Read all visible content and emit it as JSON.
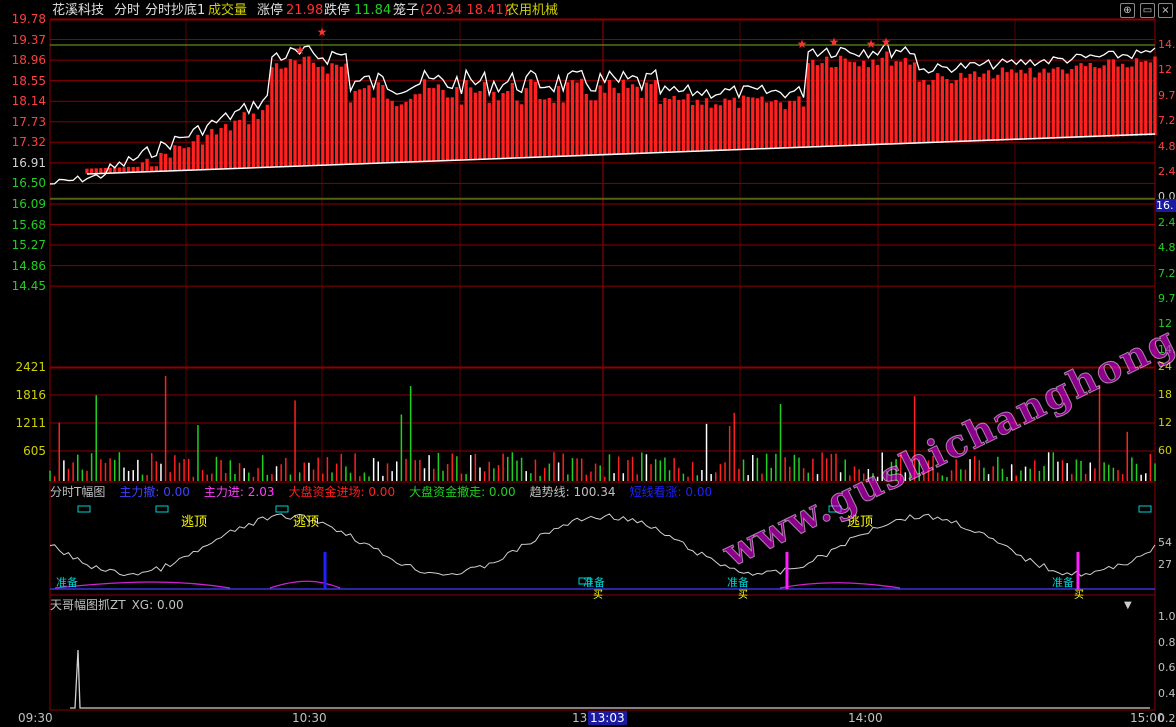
{
  "header": {
    "stock_name": "花溪科技",
    "view_label": "分时",
    "indicator_name": "分时抄底1",
    "volume_label": "成交量",
    "limit_up_label": "涨停",
    "limit_up_value": "21.98",
    "limit_down_label": "跌停",
    "limit_down_value": "11.84",
    "box_label": "笼子",
    "box_value": "(20.34 18.41)",
    "sector": "农用机械",
    "buttons": [
      "restore-icon",
      "minimize-icon",
      "close-icon"
    ]
  },
  "price_axis_left": [
    "19.78",
    "19.37",
    "18.96",
    "18.55",
    "18.14",
    "17.73",
    "17.32",
    "16.91",
    "16.50",
    "16.09",
    "15.68",
    "15.27",
    "14.86",
    "14.45"
  ],
  "pct_axis_right": [
    "14.",
    "12",
    "9.7",
    "7.2",
    "4.8",
    "2.4",
    "0.0",
    "2.4",
    "4.8",
    "7.2",
    "9.7",
    "12",
    "14."
  ],
  "current_price_tag": "16.",
  "volume_axis_left": [
    "2421",
    "1816",
    "1211",
    "605"
  ],
  "volume_axis_right": [
    "24",
    "18",
    "12",
    "60"
  ],
  "indicator1": {
    "title": "分时T幅图",
    "items": [
      {
        "label": "主力撤: 0.00",
        "color": "#4040ff"
      },
      {
        "label": "主力进: 2.03",
        "color": "#ff40ff"
      },
      {
        "label": "大盘资金进场: 0.00",
        "color": "#ff2020"
      },
      {
        "label": "大盘资金撤走: 0.00",
        "color": "#20d020"
      },
      {
        "label": "趋势线: 100.34",
        "color": "#c0c0c0"
      },
      {
        "label": "短线看涨: 0.00",
        "color": "#2020ff"
      }
    ],
    "right_axis": [
      "54",
      "27"
    ],
    "escape_labels": [
      "逃顶",
      "逃顶",
      "逃顶"
    ],
    "bottom_labels": [
      "准备",
      "准备",
      "准备",
      "准备"
    ],
    "buy_labels": [
      "买",
      "买",
      "买"
    ]
  },
  "indicator2": {
    "title": "天哥幅图抓ZT",
    "value": "XG: 0.00",
    "right_axis": [
      "1.0",
      "0.8",
      "0.6",
      "0.4",
      "0.2"
    ]
  },
  "time_axis": [
    "09:30",
    "10:30",
    "13",
    "13:03",
    "14:00",
    "15:00"
  ],
  "watermark": "www.gushichanghong.com",
  "colors": {
    "up": "#ff2020",
    "down": "#20d020",
    "grid": "#8b0000",
    "price_line": "#ffffff",
    "avg_line": "#ffff00",
    "cyan": "#00d0d0"
  }
}
